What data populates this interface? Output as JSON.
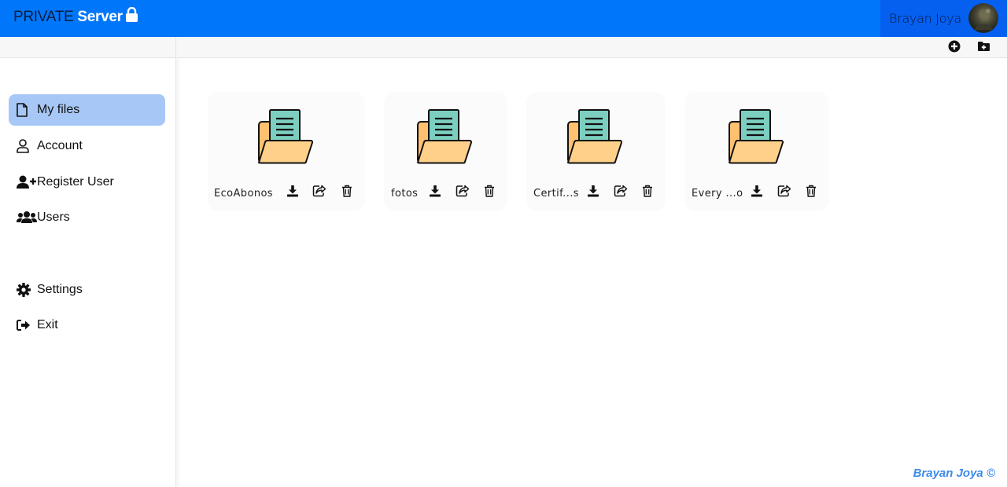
{
  "header": {
    "brand_light": "PRIVATE",
    "brand_bold": "Server",
    "brand_icon": "lock-icon",
    "user_name": "Brayan Joya"
  },
  "sidebar": {
    "items": [
      {
        "label": "My files",
        "icon": "file-icon",
        "active": true
      },
      {
        "label": "Account",
        "icon": "user-icon",
        "active": false
      },
      {
        "label": "Register User",
        "icon": "user-plus-icon",
        "active": false
      },
      {
        "label": "Users",
        "icon": "users-icon",
        "active": false
      },
      {
        "label": "Settings",
        "icon": "gear-icon",
        "active": false
      },
      {
        "label": "Exit",
        "icon": "sign-out-icon",
        "active": false
      }
    ]
  },
  "toolbar": {
    "buttons": [
      {
        "icon": "plus-circle-icon"
      },
      {
        "icon": "folder-plus-icon"
      }
    ]
  },
  "folders": [
    {
      "name": "EcoAbonos",
      "actions": [
        "download-icon",
        "share-icon",
        "trash-icon"
      ]
    },
    {
      "name": "fotos",
      "actions": [
        "download-icon",
        "share-icon",
        "trash-icon"
      ]
    },
    {
      "name": "Certif...s",
      "actions": [
        "download-icon",
        "share-icon",
        "trash-icon"
      ]
    },
    {
      "name": "Every ...o",
      "actions": [
        "download-icon",
        "share-icon",
        "trash-icon"
      ]
    }
  ],
  "footer": {
    "text": "Brayan Joya ©"
  },
  "colors": {
    "header": "#0077fb",
    "header_user_block": "#0560f0",
    "sidebar_active": "#a7c8f6",
    "footer_text": "#3e8bea",
    "folder_body": "#ffd08a",
    "folder_doc": "#7ccfc0"
  }
}
